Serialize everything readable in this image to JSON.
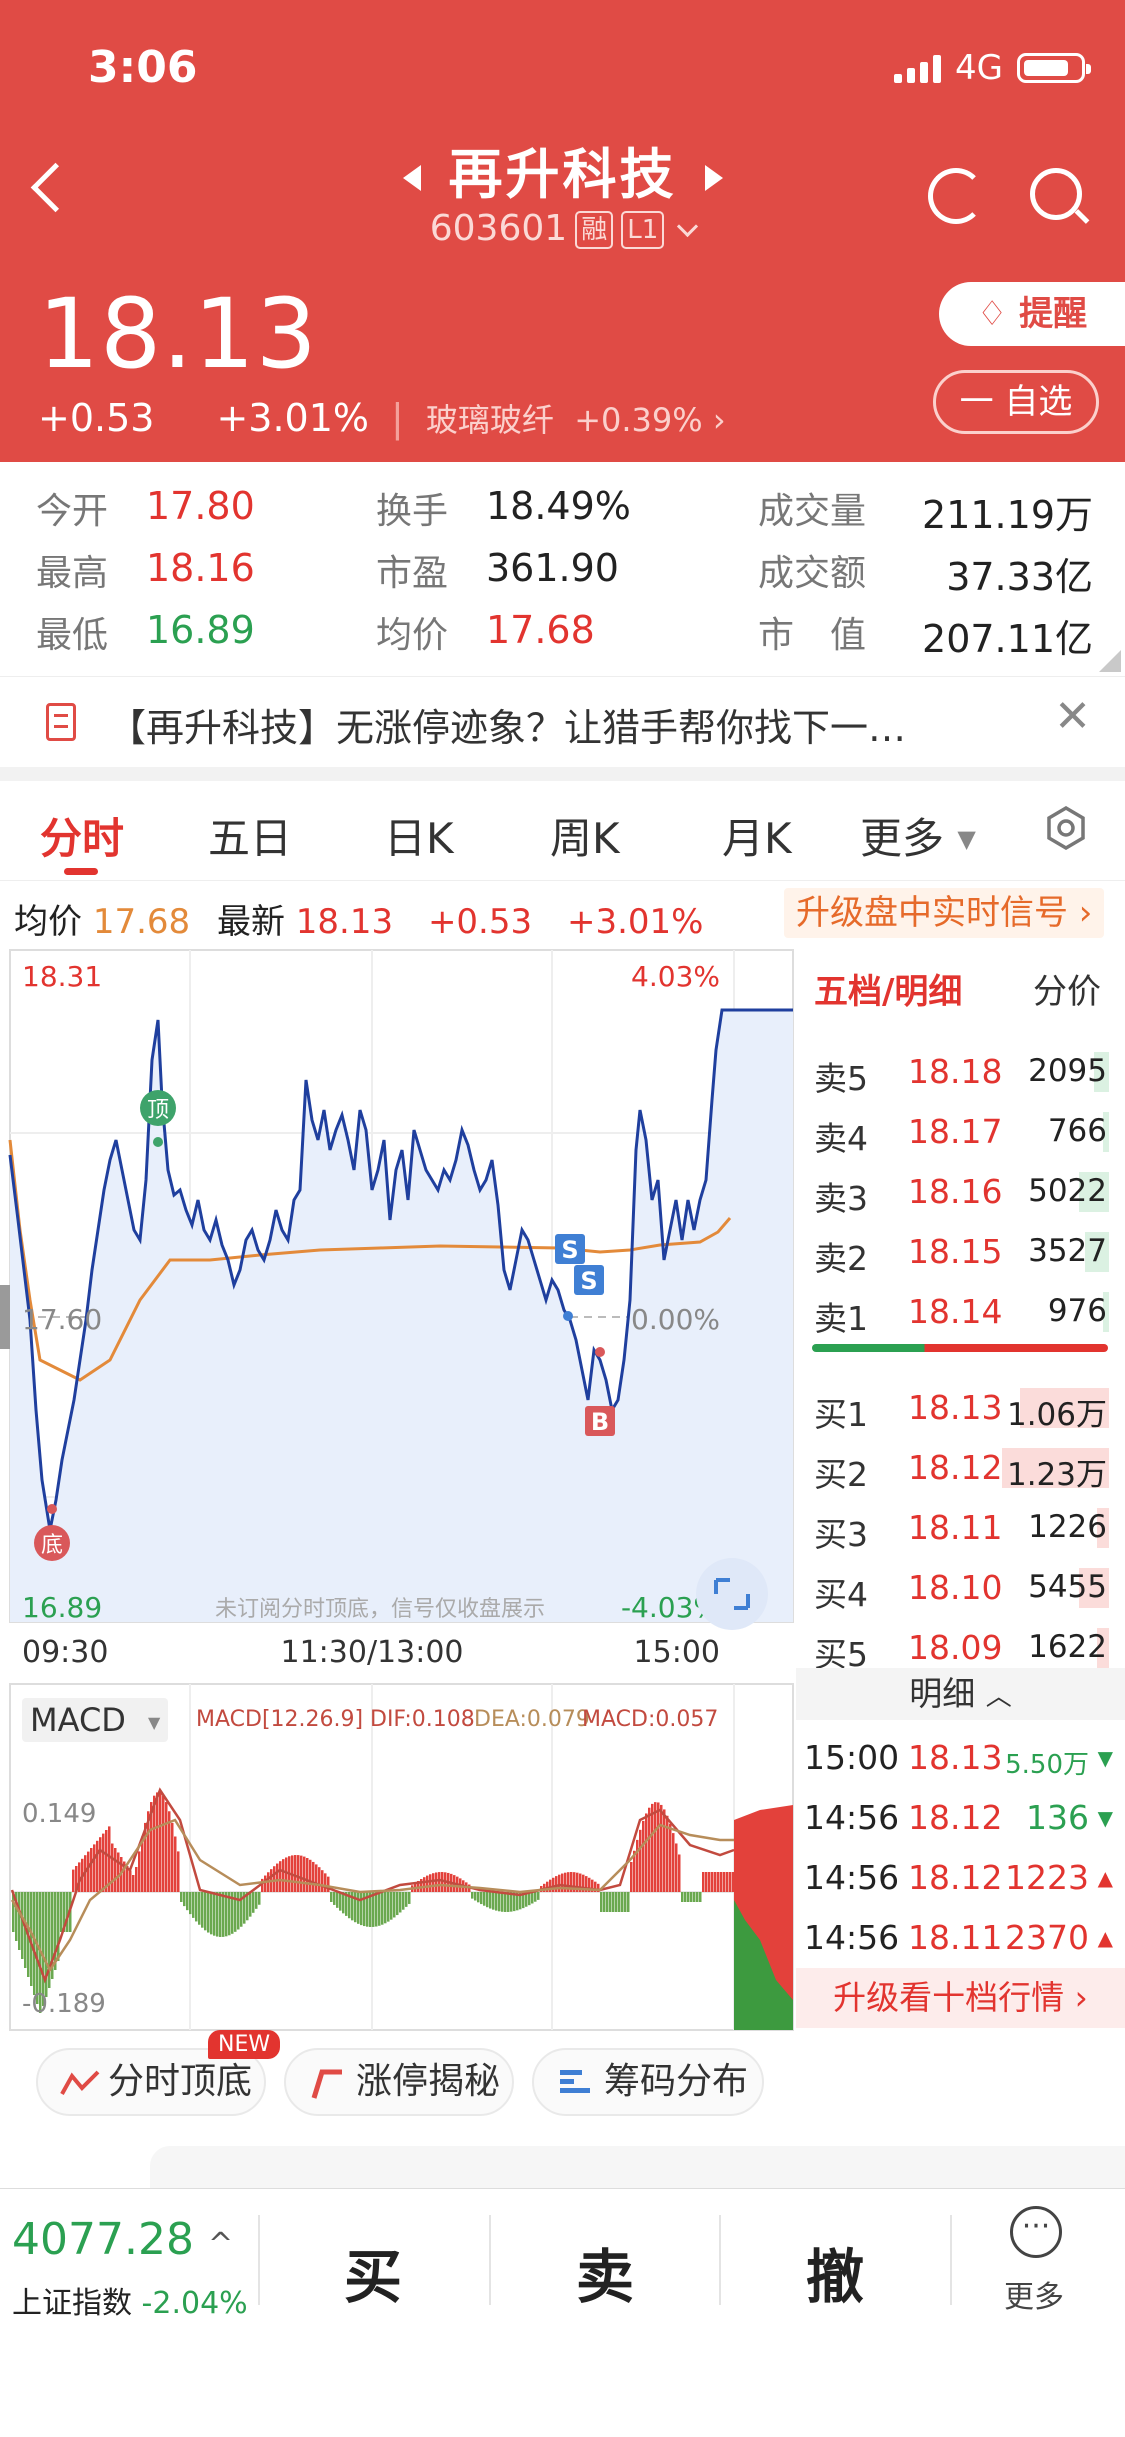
{
  "status": {
    "time": "3:06",
    "network": "4G"
  },
  "header": {
    "stock_name": "再升科技",
    "stock_code": "603601",
    "tag_margin": "融",
    "tag_level": "L1",
    "price": "18.13",
    "change": "+0.53",
    "change_pct": "+3.01%",
    "sector_name": "玻璃玻纤",
    "sector_change": "+0.39%",
    "remind_label": "提醒",
    "watch_label": "一 自选"
  },
  "stats": [
    {
      "label": "今开",
      "value": "17.80"
    },
    {
      "label": "最高",
      "value": "18.16"
    },
    {
      "label": "最低",
      "value": "16.89"
    },
    {
      "label": "换手",
      "value": "18.49%"
    },
    {
      "label": "市盈",
      "value": "361.90"
    },
    {
      "label": "均价",
      "value": "17.68"
    },
    {
      "label": "成交量",
      "value": "211.19万"
    },
    {
      "label": "成交额",
      "value": "37.33亿"
    },
    {
      "label": "市　值",
      "value": "207.11亿"
    }
  ],
  "news": {
    "text": "【再升科技】无涨停迹象？让猎手帮你找下一…"
  },
  "tabs": [
    "分时",
    "五日",
    "日K",
    "周K",
    "月K",
    "更多"
  ],
  "quote_bar": {
    "avg_label": "均价",
    "avg_value": "17.68",
    "latest_label": "最新",
    "latest_value": "18.13",
    "change": "+0.53",
    "change_pct": "+3.01%",
    "upgrade": "升级盘中实时信号"
  },
  "chart_labels": {
    "y_high": "18.31",
    "y_mid": "17.60",
    "y_low": "16.89",
    "pct_high": "4.03%",
    "pct_mid": "0.00%",
    "pct_low": "-4.03%",
    "times": [
      "09:30",
      "11:30/13:00",
      "15:00"
    ],
    "watermark": "未订阅分时顶底，信号仅收盘展示",
    "top_marker": "顶",
    "bottom_marker": "底",
    "buy_marker": "B",
    "sell_marker": "S"
  },
  "macd": {
    "selector": "MACD",
    "params": "MACD[12.26.9]",
    "dif": "DIF:0.108",
    "dea": "DEA:0.079",
    "macd_val": "MACD:0.057",
    "y_high": "0.149",
    "y_low": "-0.189"
  },
  "order_book": {
    "header_left": "五档/明细",
    "header_right": "分价",
    "asks": [
      {
        "label": "卖5",
        "price": "18.18",
        "vol": "2095",
        "share": 0.05
      },
      {
        "label": "卖4",
        "price": "18.17",
        "vol": "766",
        "share": 0.02
      },
      {
        "label": "卖3",
        "price": "18.16",
        "vol": "5022",
        "share": 0.1
      },
      {
        "label": "卖2",
        "price": "18.15",
        "vol": "3527",
        "share": 0.08
      },
      {
        "label": "卖1",
        "price": "18.14",
        "vol": "976",
        "share": 0.02
      }
    ],
    "bids": [
      {
        "label": "买1",
        "price": "18.13",
        "vol": "1.06万",
        "share": 0.3
      },
      {
        "label": "买2",
        "price": "18.12",
        "vol": "1.23万",
        "share": 0.36
      },
      {
        "label": "买3",
        "price": "18.11",
        "vol": "1226",
        "share": 0.04
      },
      {
        "label": "买4",
        "price": "18.10",
        "vol": "5455",
        "share": 0.1
      },
      {
        "label": "买5",
        "price": "18.09",
        "vol": "1622",
        "share": 0.04
      }
    ],
    "detail_header": "明细",
    "trades": [
      {
        "time": "15:00",
        "price": "18.13",
        "vol": "5.50万",
        "dir": "down"
      },
      {
        "time": "14:56",
        "price": "18.12",
        "vol": "136",
        "dir": "down"
      },
      {
        "time": "14:56",
        "price": "18.12",
        "vol": "1223",
        "dir": "up"
      },
      {
        "time": "14:56",
        "price": "18.11",
        "vol": "2370",
        "dir": "up"
      }
    ],
    "upgrade_ten": "升级看十档行情"
  },
  "features": [
    {
      "label": "分时顶底",
      "badge": "NEW"
    },
    {
      "label": "涨停揭秘"
    },
    {
      "label": "筹码分布"
    }
  ],
  "bottom": {
    "index_value": "4077.28",
    "index_name": "上证指数",
    "index_change": "-2.04%",
    "buy": "买",
    "sell": "卖",
    "cancel": "撤",
    "more": "更多"
  },
  "colors": {
    "brand_red": "#e04b45",
    "up": "#e2342f",
    "down": "#2ba051",
    "price_line": "#1f3f9e",
    "avg_line": "#e38a3a"
  }
}
